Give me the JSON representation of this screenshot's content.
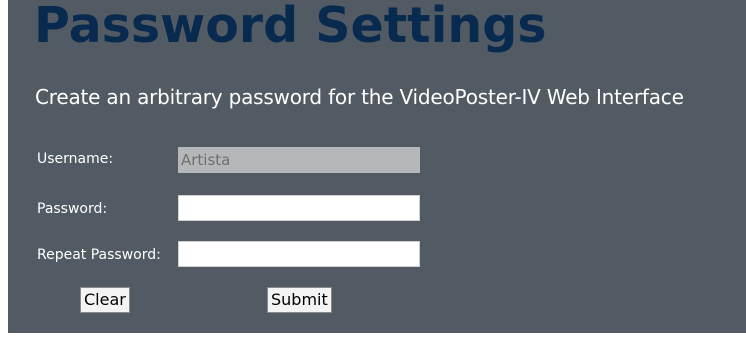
{
  "page": {
    "title": "Password Settings",
    "subtitle": "Create an arbitrary password for the VideoPoster-IV Web Interface"
  },
  "form": {
    "username_label": "Username:",
    "username_value": "Artista",
    "password_label": "Password:",
    "password_value": "",
    "repeat_label": "Repeat Password:",
    "repeat_value": ""
  },
  "buttons": {
    "clear_label": "Clear",
    "submit_label": "Submit"
  },
  "colors": {
    "panel_background": "#525a63",
    "title_color": "#082a4f",
    "disabled_field": "#b6b7b9"
  }
}
